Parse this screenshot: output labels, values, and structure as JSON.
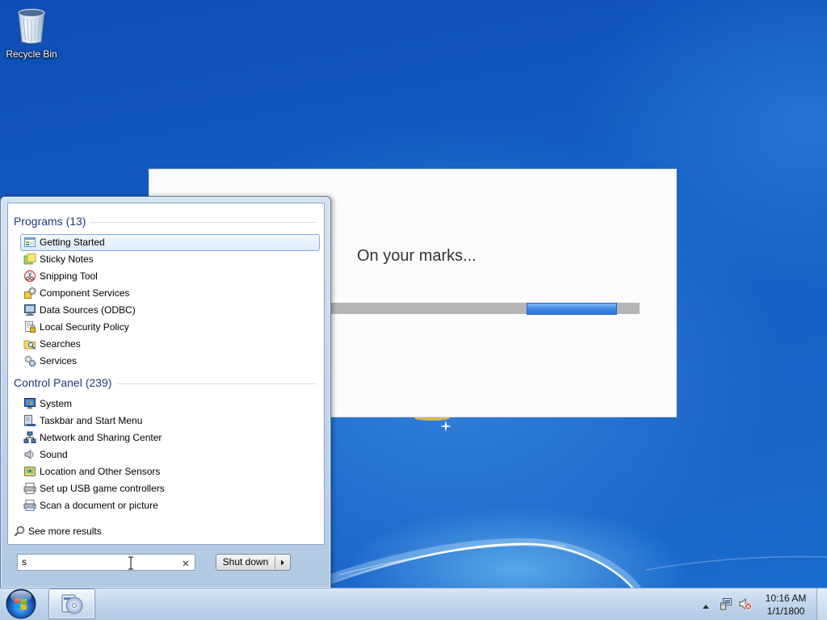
{
  "colors": {
    "desktop_blue": "#1a62c6",
    "group_header": "#1e3a78",
    "highlight_border": "#84acdd",
    "progress_blue": "#3a86e4",
    "progress_track": "#b5b5b5"
  },
  "desktop": {
    "icons": [
      {
        "label": "Recycle Bin",
        "icon": "recycle-bin-icon"
      }
    ]
  },
  "splash": {
    "message": "On your marks...",
    "progress": {
      "indeterminate": true
    }
  },
  "start_menu": {
    "programs": {
      "header": "Programs (13)",
      "items": [
        {
          "label": "Getting Started",
          "icon": "getting-started-icon",
          "selected": true
        },
        {
          "label": "Sticky Notes",
          "icon": "sticky-notes-icon"
        },
        {
          "label": "Snipping Tool",
          "icon": "snipping-tool-icon"
        },
        {
          "label": "Component Services",
          "icon": "component-services-icon"
        },
        {
          "label": "Data Sources (ODBC)",
          "icon": "data-sources-icon"
        },
        {
          "label": "Local Security Policy",
          "icon": "local-security-policy-icon"
        },
        {
          "label": "Searches",
          "icon": "searches-icon"
        },
        {
          "label": "Services",
          "icon": "services-icon"
        }
      ]
    },
    "control_panel": {
      "header": "Control Panel (239)",
      "items": [
        {
          "label": "System",
          "icon": "system-icon"
        },
        {
          "label": "Taskbar and Start Menu",
          "icon": "taskbar-start-menu-icon"
        },
        {
          "label": "Network and Sharing Center",
          "icon": "network-sharing-icon"
        },
        {
          "label": "Sound",
          "icon": "sound-icon"
        },
        {
          "label": "Location and Other Sensors",
          "icon": "location-sensors-icon"
        },
        {
          "label": "Set up USB game controllers",
          "icon": "game-controllers-icon"
        },
        {
          "label": "Scan a document or picture",
          "icon": "scanner-icon"
        }
      ]
    },
    "see_more": {
      "label": "See more results",
      "icon": "search-icon"
    },
    "search": {
      "value": "s",
      "clear_icon": "close-icon"
    },
    "shutdown": {
      "label": "Shut down",
      "options_icon": "chevron-right-icon"
    }
  },
  "taskbar": {
    "start_icon": "windows-start-orb-icon",
    "pinned": [
      {
        "icon": "installer-disc-icon",
        "active": true
      }
    ],
    "tray_icons": [
      "show-hidden-icons-icon",
      "network-icon",
      "volume-muted-icon"
    ],
    "clock": {
      "time": "10:16 AM",
      "date": "1/1/1800"
    }
  }
}
